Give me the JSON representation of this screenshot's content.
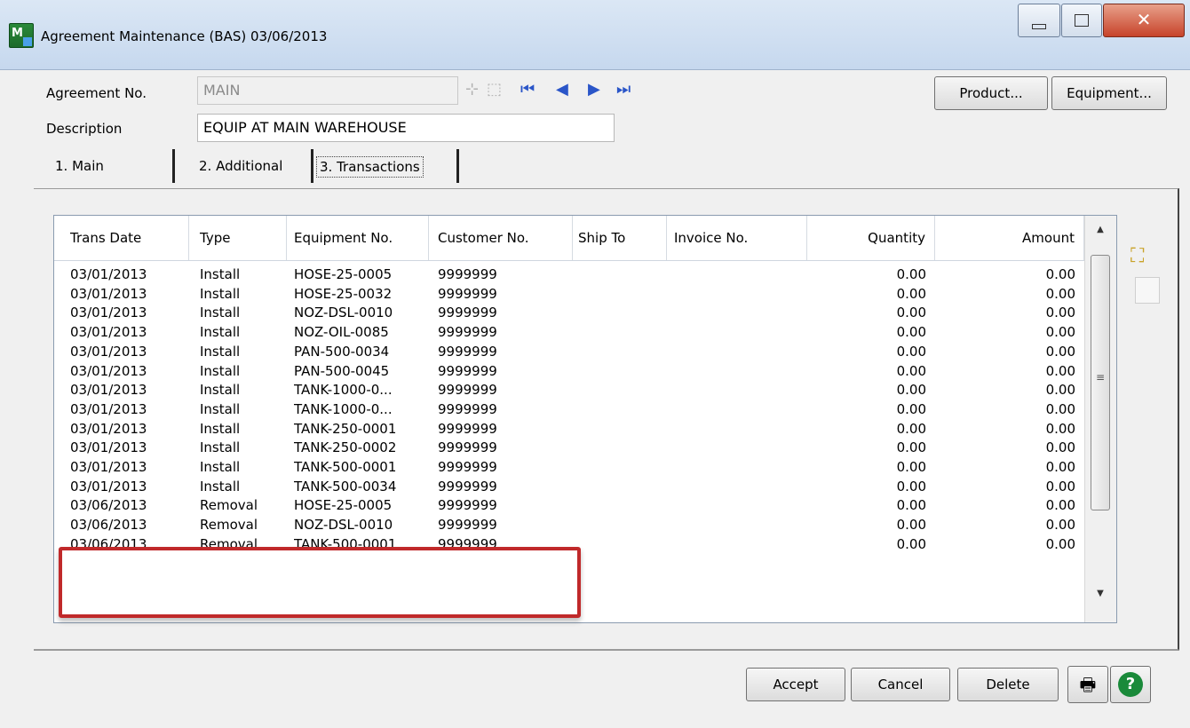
{
  "window": {
    "title": "Agreement Maintenance (BAS) 03/06/2013",
    "icon": "sage-mas-app-icon"
  },
  "header": {
    "agreement_label": "Agreement No.",
    "agreement_value": "MAIN",
    "description_label": "Description",
    "description_value": "EQUIP AT MAIN WAREHOUSE",
    "product_button": "Product...",
    "equipment_button": "Equipment..."
  },
  "tabs": [
    {
      "label": "1. Main",
      "active": false
    },
    {
      "label": "2. Additional",
      "active": false
    },
    {
      "label": "3. Transactions",
      "active": true
    }
  ],
  "grid": {
    "columns": [
      "Trans Date",
      "Type",
      "Equipment No.",
      "Customer No.",
      "Ship To",
      "Invoice No.",
      "Quantity",
      "Amount"
    ],
    "rows": [
      [
        "03/01/2013",
        "Install",
        "HOSE-25-0005",
        "9999999",
        "",
        "",
        "0.00",
        "0.00"
      ],
      [
        "03/01/2013",
        "Install",
        "HOSE-25-0032",
        "9999999",
        "",
        "",
        "0.00",
        "0.00"
      ],
      [
        "03/01/2013",
        "Install",
        "NOZ-DSL-0010",
        "9999999",
        "",
        "",
        "0.00",
        "0.00"
      ],
      [
        "03/01/2013",
        "Install",
        "NOZ-OIL-0085",
        "9999999",
        "",
        "",
        "0.00",
        "0.00"
      ],
      [
        "03/01/2013",
        "Install",
        "PAN-500-0034",
        "9999999",
        "",
        "",
        "0.00",
        "0.00"
      ],
      [
        "03/01/2013",
        "Install",
        "PAN-500-0045",
        "9999999",
        "",
        "",
        "0.00",
        "0.00"
      ],
      [
        "03/01/2013",
        "Install",
        "TANK-1000-0...",
        "9999999",
        "",
        "",
        "0.00",
        "0.00"
      ],
      [
        "03/01/2013",
        "Install",
        "TANK-1000-0...",
        "9999999",
        "",
        "",
        "0.00",
        "0.00"
      ],
      [
        "03/01/2013",
        "Install",
        "TANK-250-0001",
        "9999999",
        "",
        "",
        "0.00",
        "0.00"
      ],
      [
        "03/01/2013",
        "Install",
        "TANK-250-0002",
        "9999999",
        "",
        "",
        "0.00",
        "0.00"
      ],
      [
        "03/01/2013",
        "Install",
        "TANK-500-0001",
        "9999999",
        "",
        "",
        "0.00",
        "0.00"
      ],
      [
        "03/01/2013",
        "Install",
        "TANK-500-0034",
        "9999999",
        "",
        "",
        "0.00",
        "0.00"
      ],
      [
        "03/06/2013",
        "Removal",
        "HOSE-25-0005",
        "9999999",
        "",
        "",
        "0.00",
        "0.00"
      ],
      [
        "03/06/2013",
        "Removal",
        "NOZ-DSL-0010",
        "9999999",
        "",
        "",
        "0.00",
        "0.00"
      ],
      [
        "03/06/2013",
        "Removal",
        "TANK-500-0001",
        "9999999",
        "",
        "",
        "0.00",
        "0.00"
      ]
    ]
  },
  "footer": {
    "accept_label": "Accept",
    "cancel_label": "Cancel",
    "delete_label": "Delete"
  },
  "colors": {
    "highlight": "#c0292a",
    "nav_arrow": "#2a55c8",
    "help": "#1a8a3a"
  }
}
